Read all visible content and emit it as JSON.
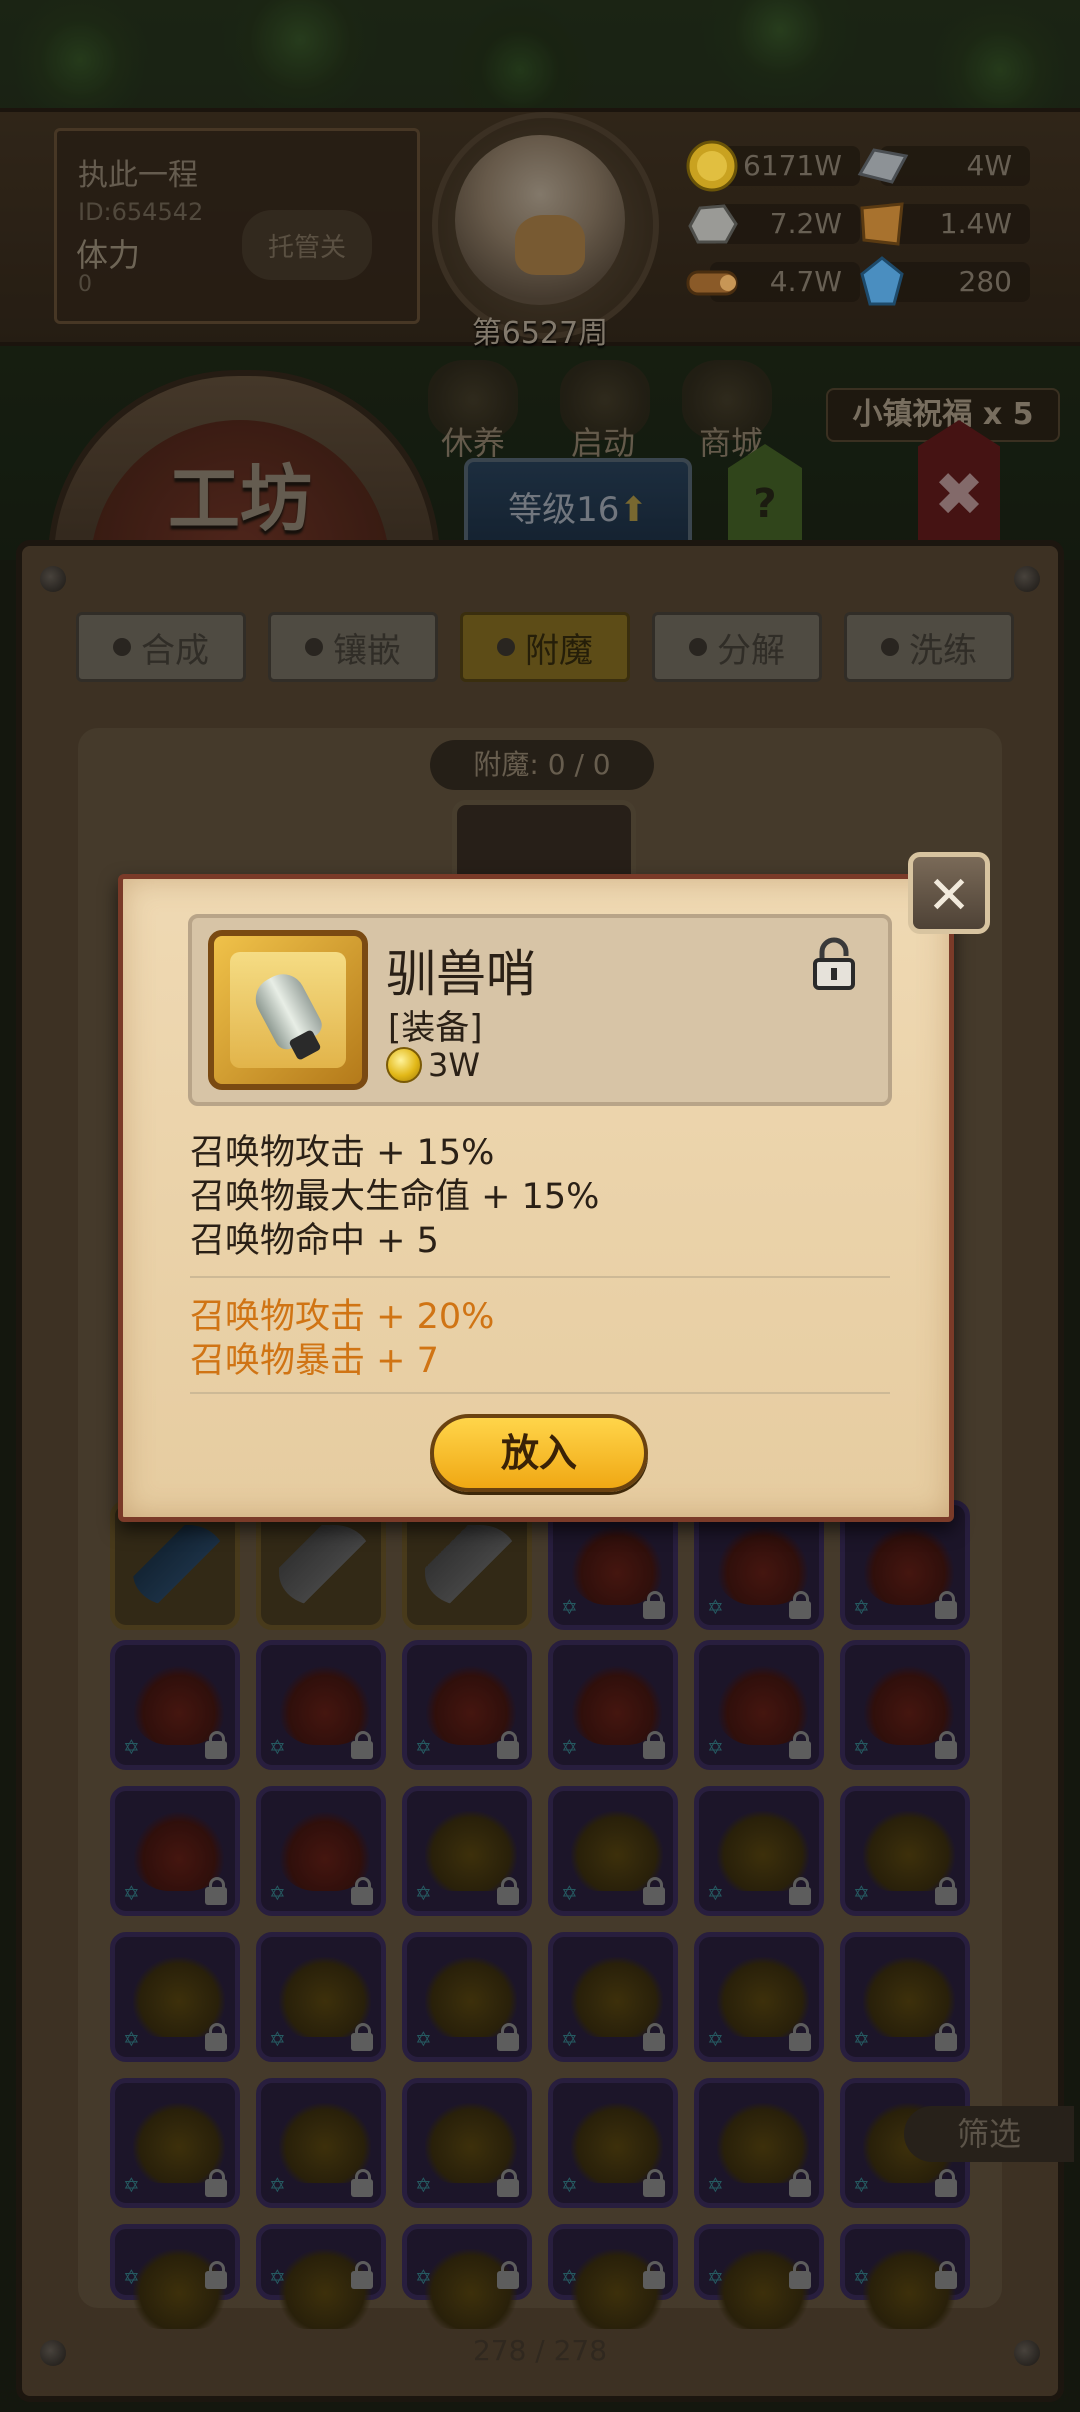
{
  "hud": {
    "player_name": "执此一程",
    "player_id": "ID:654542",
    "stamina_label": "体力",
    "stamina_value": "0",
    "auto_button": "托管关",
    "week": "第6527周",
    "resources": {
      "gold": "6171W",
      "iron": "4W",
      "stone": "7.2W",
      "leather": "1.4W",
      "wood": "4.7W",
      "crystal": "280"
    }
  },
  "nav": {
    "items": [
      "休养",
      "启动",
      "商城"
    ],
    "blessing": "小镇祝福 x 5",
    "workshop_title": "工坊",
    "level_label": "等级16",
    "help": "?"
  },
  "tabs": [
    {
      "label": "合成",
      "active": false
    },
    {
      "label": "镶嵌",
      "active": false
    },
    {
      "label": "附魔",
      "active": true
    },
    {
      "label": "分解",
      "active": false
    },
    {
      "label": "洗练",
      "active": false
    }
  ],
  "enchant": {
    "count_label": "附魔: 0 / 0"
  },
  "inventory": {
    "filter_label": "筛选",
    "page_counter": "278 / 278"
  },
  "modal": {
    "item_name": "驯兽哨",
    "item_type": "[装备]",
    "price": "3W",
    "base_stats": [
      "召唤物攻击 + 15%",
      "召唤物最大生命值 + 15%",
      "召唤物命中 + 5"
    ],
    "bonus_stats": [
      "召唤物攻击 + 20%",
      "召唤物暴击 + 7"
    ],
    "put_in_button": "放入",
    "bonus_color": "#d07414"
  },
  "icons": {
    "gold": "gold-coin-icon",
    "iron": "iron-ingot-icon",
    "stone": "stone-icon",
    "leather": "leather-icon",
    "wood": "wood-log-icon",
    "crystal": "crystal-icon",
    "lock": "padlock-icon",
    "close": "close-icon"
  }
}
